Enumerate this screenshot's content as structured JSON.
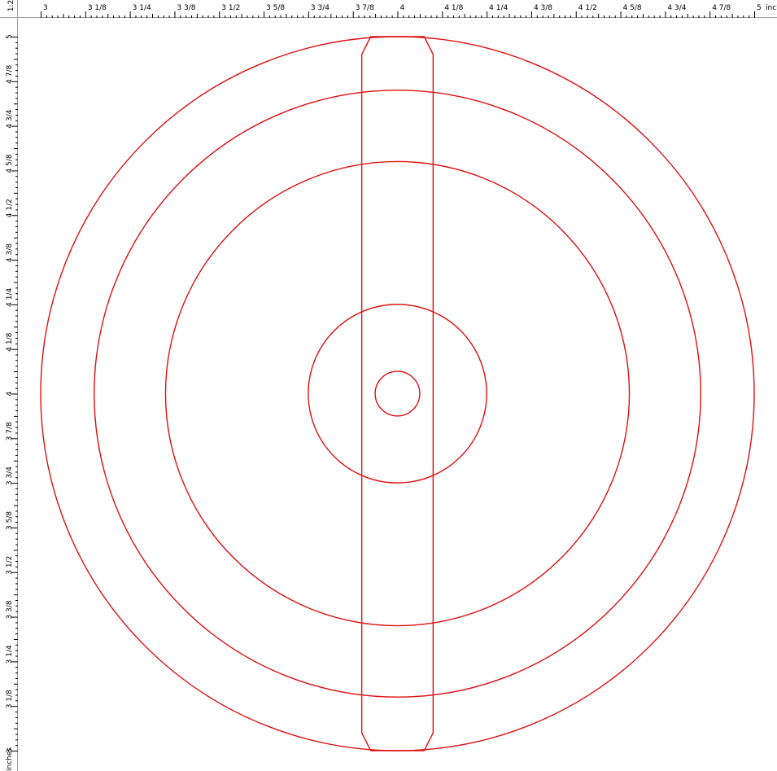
{
  "corner_label": "1:2",
  "horizontal_ruler": {
    "unit_label": "inches",
    "labels": [
      "3",
      "3  1/8",
      "3  1/4",
      "3  3/8",
      "3  1/2",
      "3  5/8",
      "3  3/4",
      "3  7/8",
      "4",
      "4  1/8",
      "4  1/4",
      "4  3/8",
      "4  1/2",
      "4  5/8",
      "4  3/4",
      "4  7/8",
      "5"
    ]
  },
  "vertical_ruler": {
    "unit_label": "inches",
    "labels": [
      "5",
      "4  7/8",
      "4  3/4",
      "4  5/8",
      "4  1/2",
      "4  3/8",
      "4  1/4",
      "4  1/8",
      "4",
      "3  7/8",
      "3  3/4",
      "3  5/8",
      "3  1/2",
      "3  3/8",
      "3  1/4",
      "3  1/8",
      "3"
    ]
  },
  "drawing": {
    "stroke_color": "#e01010",
    "circles": [
      {
        "name": "outer-circle",
        "diameter_in": 2.0
      },
      {
        "name": "second-circle",
        "diameter_in": 1.7
      },
      {
        "name": "third-circle",
        "diameter_in": 1.3
      },
      {
        "name": "hub-circle",
        "diameter_in": 0.5
      },
      {
        "name": "center-hole",
        "diameter_in": 0.125
      }
    ],
    "slot": {
      "name": "vertical-slot",
      "width_in": 0.2,
      "end_width_in": 0.15,
      "chamfer_in": 0.05
    },
    "center_in": [
      4,
      4
    ]
  }
}
